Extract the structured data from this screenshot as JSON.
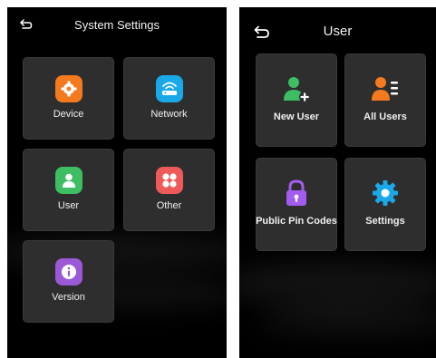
{
  "system_settings": {
    "title": "System Settings",
    "back_icon": "back-arrow-icon",
    "tiles": [
      {
        "label": "Device",
        "icon": "gear-icon",
        "color": "#F47A20"
      },
      {
        "label": "Network",
        "icon": "wifi-router-icon",
        "color": "#1AA9E8"
      },
      {
        "label": "User",
        "icon": "user-icon",
        "color": "#3DBE63"
      },
      {
        "label": "Other",
        "icon": "grid-icon",
        "color": "#EE5A5A"
      },
      {
        "label": "Version",
        "icon": "info-icon",
        "color": "#9B59D6"
      }
    ]
  },
  "user": {
    "title": "User",
    "back_icon": "back-arrow-icon",
    "tiles": [
      {
        "label": "New User",
        "icon": "add-user-icon",
        "color": "#3DBE63"
      },
      {
        "label": "All Users",
        "icon": "user-list-icon",
        "color": "#F47A20"
      },
      {
        "label": "Public Pin Codes",
        "icon": "lock-icon",
        "color": "#A45CF0"
      },
      {
        "label": "Settings",
        "icon": "gear-icon",
        "color": "#1AA9E8"
      }
    ]
  }
}
